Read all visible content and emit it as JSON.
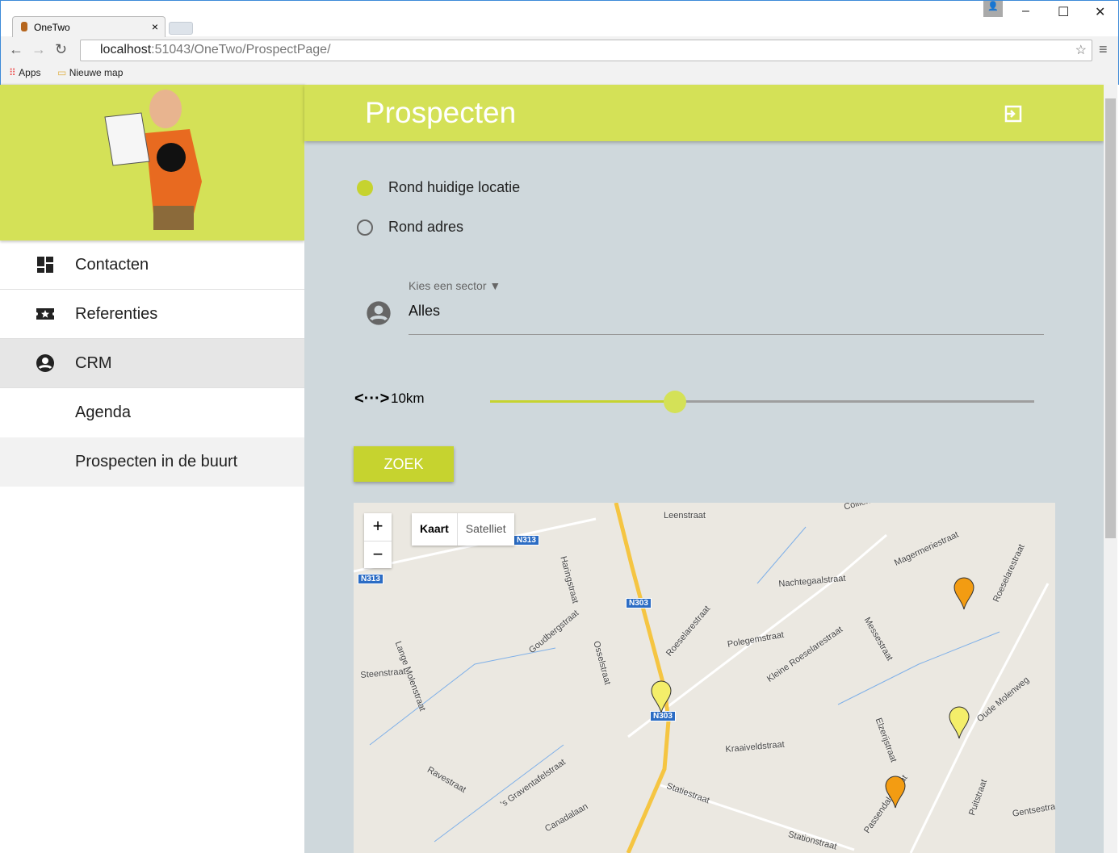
{
  "browser": {
    "tab_title": "OneTwo",
    "url_host": "localhost",
    "url_rest": ":51043/OneTwo/ProspectPage/",
    "bookmarks": [
      "Apps",
      "Nieuwe map"
    ]
  },
  "sidebar": {
    "items": [
      {
        "label": "Contacten",
        "icon": "dashboard-icon"
      },
      {
        "label": "Referenties",
        "icon": "star-ticket-icon"
      },
      {
        "label": "CRM",
        "icon": "account-circle-icon"
      },
      {
        "label": "Agenda"
      },
      {
        "label": "Prospecten in de buurt"
      }
    ]
  },
  "header": {
    "title": "Prospecten",
    "icon": "exit-icon"
  },
  "form": {
    "radio_current": "Rond huidige locatie",
    "radio_address": "Rond adres",
    "selected_radio": "Rond huidige locatie",
    "sector_label": "Kies een sector ▼",
    "sector_value": "Alles",
    "distance": "10km",
    "slider_fraction": 0.34,
    "search_button": "ZOEK"
  },
  "map": {
    "zoom_in": "+",
    "zoom_out": "−",
    "map_type": "Kaart",
    "satellite": "Satelliet",
    "roads": [
      "N313",
      "N313",
      "N303",
      "N303"
    ],
    "streets": [
      "Leenstraat",
      "Colliemolenstraat",
      "Magermeriestraat",
      "Nachtegaalstraat",
      "Haringstraat",
      "Roeselarestraat",
      "Polegemstraat",
      "Messestraat",
      "Roeselarestraat",
      "Goudbergstraat",
      "Osselstraat",
      "Lange Molenstraat",
      "Steenstraat",
      "Kleine Roeselarestraat",
      "Oude Molenweg",
      "Elzerijstraat",
      "Kraaiveldstraat",
      "Statiestraat",
      "Ravestraat",
      "'s Graventafelstraat",
      "Canadalaan",
      "Passendalestraat",
      "Puitstraat",
      "Stationstraat",
      "Gentsestraat"
    ],
    "colors": {
      "marker_orange": "#f39c12",
      "marker_yellow": "#f4ee6a"
    }
  },
  "colors": {
    "accent": "#d4e157",
    "background": "#cfd8dc"
  }
}
